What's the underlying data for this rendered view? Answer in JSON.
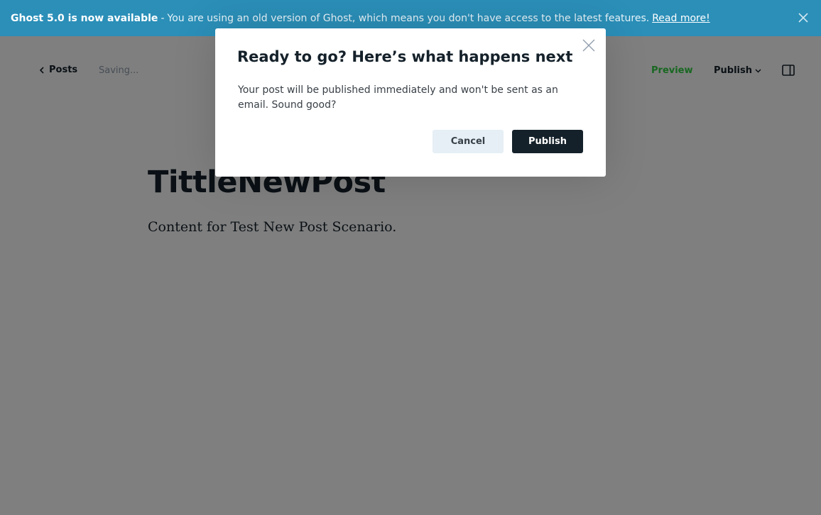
{
  "banner": {
    "headline": "Ghost 5.0 is now available",
    "separator": "-",
    "message": "You are using an old version of Ghost, which means you don't have access to the latest features.",
    "link_label": "Read more!",
    "close_icon": "close-icon"
  },
  "header": {
    "back_label": "Posts",
    "status": "Saving...",
    "preview_label": "Preview",
    "publish_label": "Publish",
    "sidebar_icon": "sidebar-toggle-icon"
  },
  "post": {
    "title": "TittleNewPost",
    "body": "Content for Test New Post Scenario."
  },
  "modal": {
    "title": "Ready to go? Here’s what happens next",
    "text": "Your post will be published immediately and won't be sent as an email. Sound good?",
    "cancel_label": "Cancel",
    "publish_label": "Publish",
    "close_icon": "close-icon"
  },
  "colors": {
    "banner": "#2b8fb8",
    "accent_green": "#30cf43",
    "dark": "#15212a",
    "overlay": "rgba(0,0,0,0.5)"
  }
}
